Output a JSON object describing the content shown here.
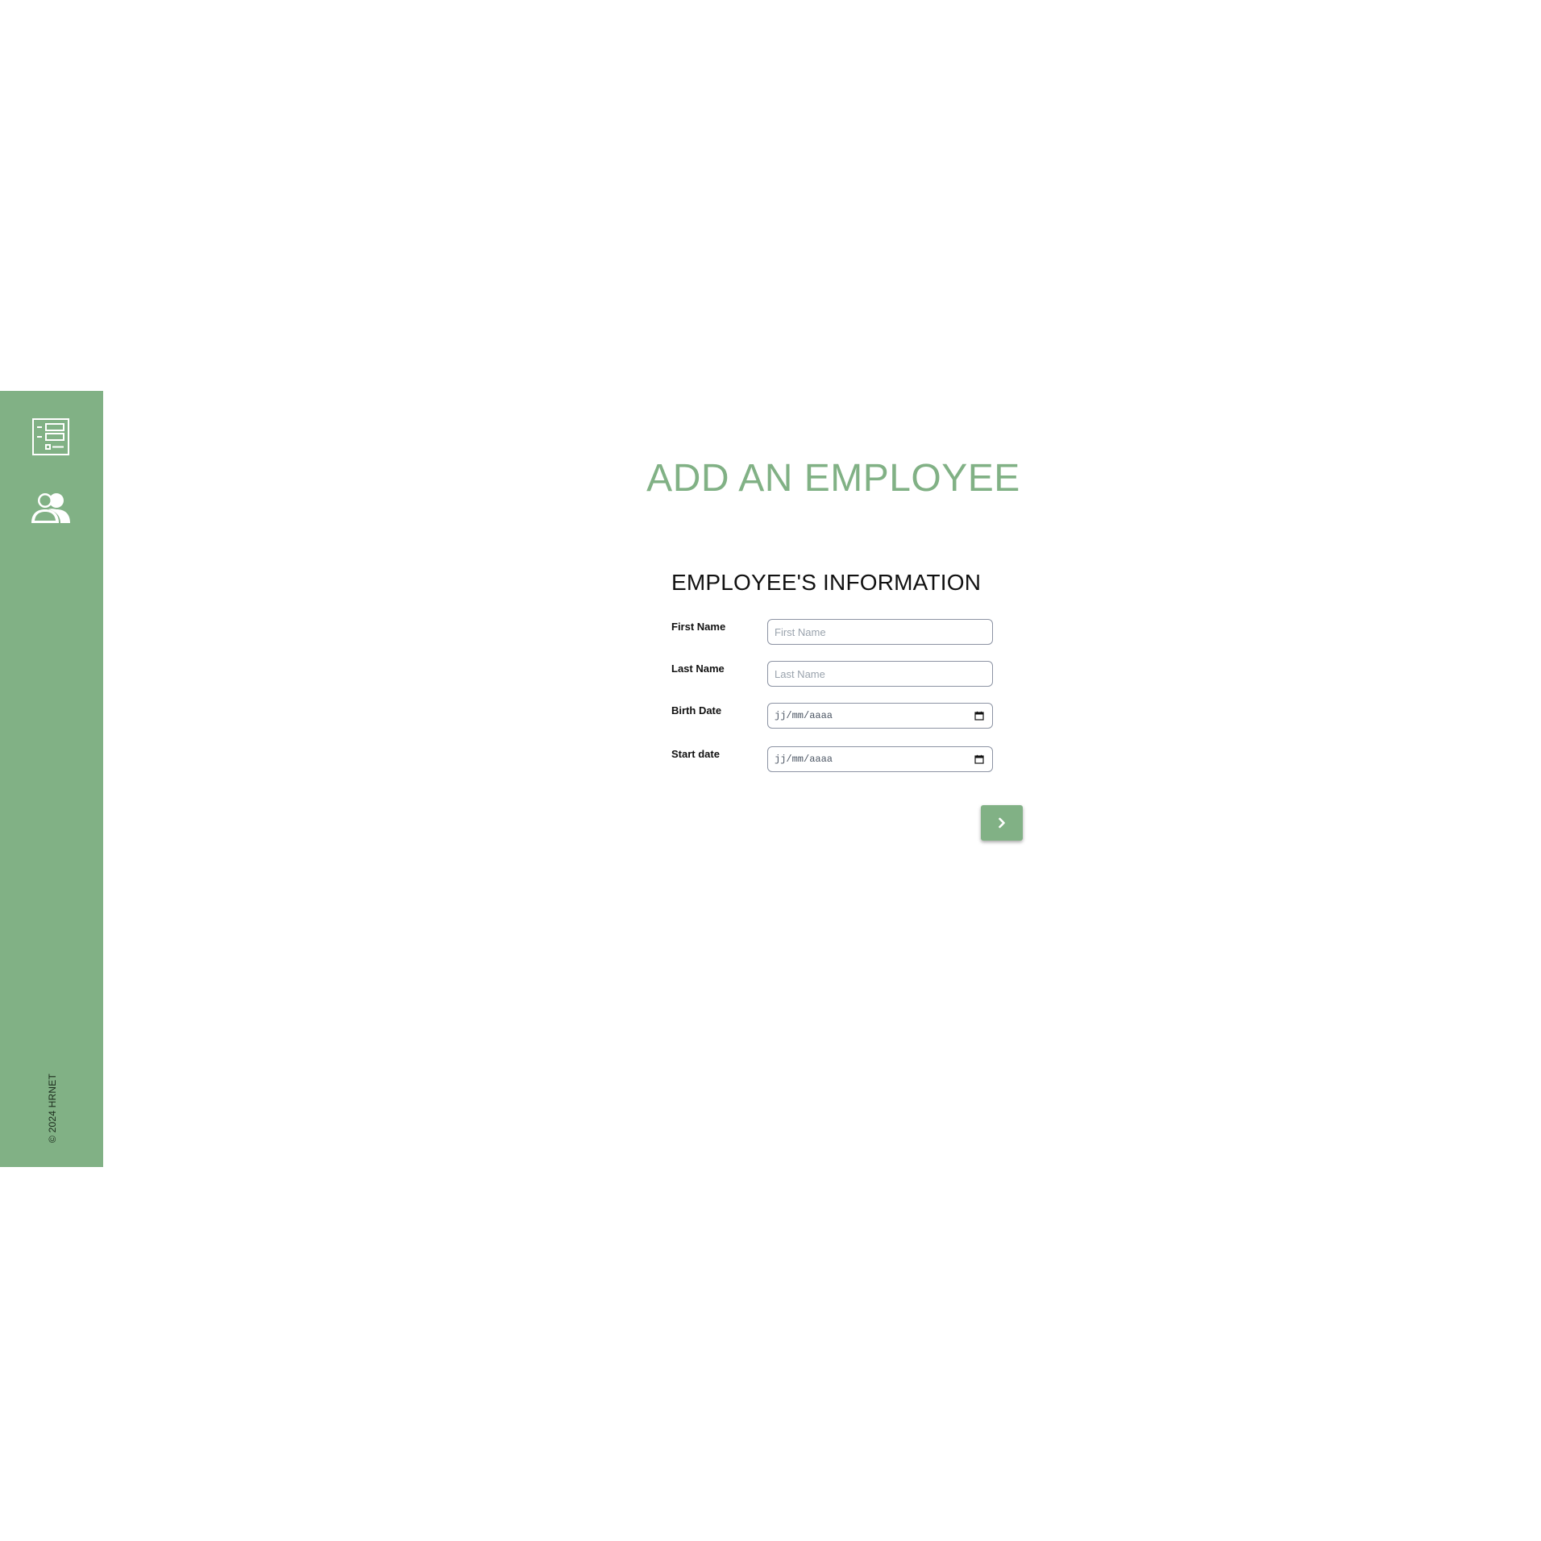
{
  "colors": {
    "accent": "#81b185",
    "sidebar_bg": "#81b185",
    "text_dark": "#111111",
    "input_border": "#8c93a3"
  },
  "sidebar": {
    "items": [
      {
        "icon": "list-icon",
        "label": ""
      },
      {
        "icon": "employees-icon",
        "label": ""
      }
    ],
    "copyright": "© 2024 HRNET"
  },
  "page": {
    "title": "ADD AN EMPLOYEE"
  },
  "form": {
    "section_title": "EMPLOYEE'S INFORMATION",
    "fields": {
      "first_name": {
        "label": "First Name",
        "placeholder": "First Name",
        "value": ""
      },
      "last_name": {
        "label": "Last Name",
        "placeholder": "Last Name",
        "value": ""
      },
      "birth_date": {
        "label": "Birth Date",
        "placeholder": "jj/mm/aaaa",
        "value": ""
      },
      "start_date": {
        "label": "Start date",
        "placeholder": "jj/mm/aaaa",
        "value": ""
      }
    },
    "next_button": {
      "icon": "chevron-right-icon"
    }
  }
}
